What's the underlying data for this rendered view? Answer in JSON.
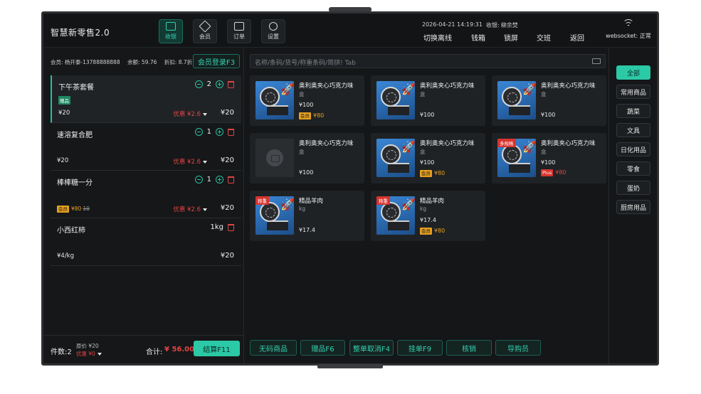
{
  "app": {
    "title": "智慧新零售2.0"
  },
  "nav": [
    {
      "label": "收银",
      "icon": "monitor-icon",
      "active": true
    },
    {
      "label": "会员",
      "icon": "diamond-icon",
      "active": false
    },
    {
      "label": "订单",
      "icon": "clipboard-icon",
      "active": false
    },
    {
      "label": "设置",
      "icon": "gear-icon",
      "active": false
    }
  ],
  "header": {
    "datetime": "2026-04-21 14:19:31",
    "cashier_label": "收银:",
    "cashier_name": "柳余焚",
    "actions": [
      "切换离线",
      "钱箱",
      "锁屏",
      "交班",
      "返回"
    ],
    "ws_status": "websocket: 正常"
  },
  "member": {
    "info": "会员: 杨开泰-13788888888",
    "balance": "余额: 59.76",
    "discount": "折扣: 8.7折",
    "login_button": "会员登录F3"
  },
  "cart": [
    {
      "name": "下午茶套餐",
      "qty": "2",
      "tag": "赠品",
      "price": "¥20",
      "discount": "优惠 ¥2.6",
      "total": "¥20",
      "selected": true
    },
    {
      "name": "速溶复合肥",
      "qty": "1",
      "price": "¥20",
      "discount": "优惠 ¥2.6",
      "total": "¥20"
    },
    {
      "name": "棒棒糖一分",
      "qty": "1",
      "member_tag": "会员",
      "member_price": "¥80",
      "orig_price": "10",
      "discount": "优惠 ¥2.6",
      "total": "¥20"
    },
    {
      "name": "小西红柿",
      "weight": "1kg",
      "price": "¥4/kg",
      "total": "¥20"
    }
  ],
  "summary": {
    "count": "件数:2",
    "orig": "原价 ¥20",
    "discount": "优惠 ¥0",
    "total_label": "合计:",
    "total_value": "¥ 56.00",
    "checkout": "结算F11"
  },
  "search": {
    "placeholder": "名称/条码/货号/称重条码/简拼! Tab"
  },
  "products": [
    {
      "name": "奥利奥夹心巧克力味",
      "unit": "盒",
      "price": "¥100",
      "member_tag": "会员",
      "member_price": "¥80"
    },
    {
      "name": "奥利奥夹心巧克力味",
      "unit": "盒",
      "price": "¥100"
    },
    {
      "name": "奥利奥夹心巧克力味",
      "unit": "盒",
      "price": "¥100"
    },
    {
      "name": "奥利奥夹心巧克力味",
      "unit": "盒",
      "price": "¥100",
      "empty_image": true
    },
    {
      "name": "奥利奥夹心巧克力味",
      "unit": "盒",
      "price": "¥100",
      "member_tag": "会员",
      "member_price": "¥80"
    },
    {
      "name": "奥利奥夹心巧克力味",
      "unit": "盒",
      "price": "¥100",
      "badge": "多规格",
      "member_tag": "Plus",
      "member_price": "¥80",
      "plus": true
    },
    {
      "name": "精品羊肉",
      "unit": "kg",
      "price": "¥17.4",
      "badge": "称重"
    },
    {
      "name": "精品羊肉",
      "unit": "kg",
      "price": "¥17.4",
      "badge": "称重",
      "member_tag": "会员",
      "member_price": "¥80"
    }
  ],
  "bottom_buttons": [
    "无码商品",
    "赠品F6",
    "整单取消F4",
    "挂单F9",
    "核销",
    "导购员"
  ],
  "categories": [
    "全部",
    "常用商品",
    "蔬菜",
    "文具",
    "日化用品",
    "零食",
    "蛋奶",
    "厨房用品"
  ],
  "colors": {
    "accent": "#2bc9a6",
    "danger": "#e04545",
    "member": "#e6a020",
    "background": "#141618"
  }
}
